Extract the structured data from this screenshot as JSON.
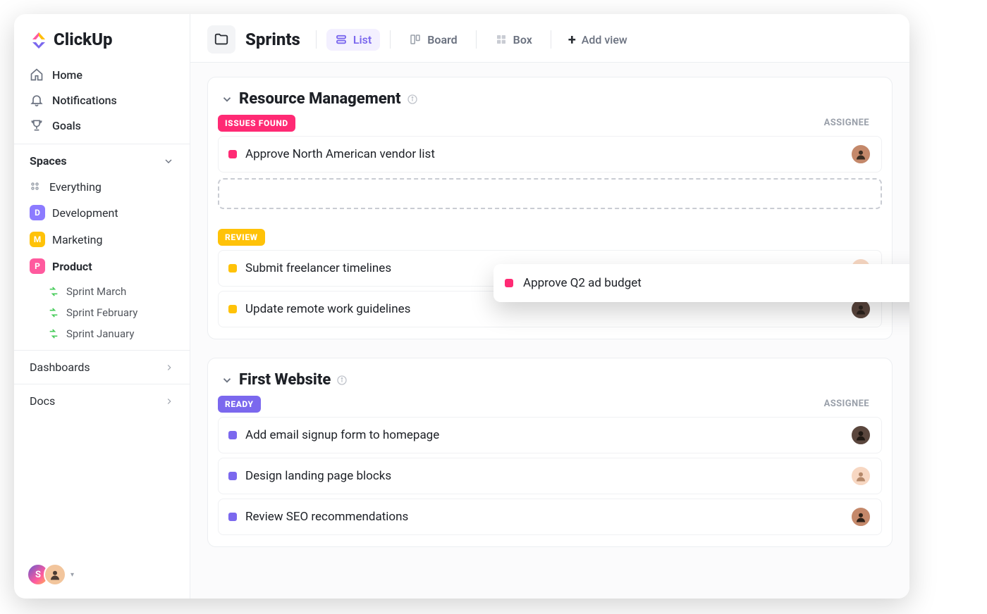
{
  "brand": {
    "name": "ClickUp"
  },
  "nav": {
    "home": "Home",
    "notifications": "Notifications",
    "goals": "Goals"
  },
  "spaces": {
    "header": "Spaces",
    "everything": "Everything",
    "items": [
      {
        "initial": "D",
        "label": "Development",
        "color": "#8C7BFF"
      },
      {
        "initial": "M",
        "label": "Marketing",
        "color": "#FFC208"
      },
      {
        "initial": "P",
        "label": "Product",
        "color": "#FF5A9E"
      }
    ],
    "children": [
      {
        "label": "Sprint  March"
      },
      {
        "label": "Sprint  February"
      },
      {
        "label": "Sprint January"
      }
    ]
  },
  "sections": {
    "dashboards": "Dashboards",
    "docs": "Docs"
  },
  "topbar": {
    "page_title": "Sprints",
    "views": {
      "list": "List",
      "board": "Board",
      "box": "Box",
      "add": "Add view"
    }
  },
  "labels": {
    "assignee": "ASSIGNEE"
  },
  "colors": {
    "accent_purple": "#7B68EE",
    "issues_found": "#FF2A74",
    "review": "#FFC208",
    "ready": "#7B68EE"
  },
  "groups": [
    {
      "title": "Resource Management",
      "blocks": [
        {
          "status_label": "ISSUES FOUND",
          "status_color": "#FF2A74",
          "tasks": [
            {
              "title": "Approve North American vendor list",
              "dot": "#FF2A74",
              "assignee": "person-1"
            }
          ],
          "show_dropzone": true
        },
        {
          "status_label": "REVIEW",
          "status_color": "#FFC208",
          "tasks": [
            {
              "title": "Submit freelancer timelines",
              "dot": "#FFC208",
              "assignee": "person-2"
            },
            {
              "title": "Update remote work guidelines",
              "dot": "#FFC208",
              "assignee": "person-3"
            }
          ]
        }
      ]
    },
    {
      "title": "First Website",
      "blocks": [
        {
          "status_label": "READY",
          "status_color": "#7B68EE",
          "tasks": [
            {
              "title": "Add email signup form to homepage",
              "dot": "#7B68EE",
              "assignee": "person-4"
            },
            {
              "title": "Design landing page blocks",
              "dot": "#7B68EE",
              "assignee": "person-5"
            },
            {
              "title": "Review SEO recommendations",
              "dot": "#7B68EE",
              "assignee": "person-6"
            }
          ]
        }
      ]
    }
  ],
  "drag": {
    "title": "Approve Q2 ad budget",
    "dot": "#FF2A74",
    "assignee": "person-7"
  },
  "assignee_colors": {
    "person-1": "skin3",
    "person-2": "skin5",
    "person-3": "skin4",
    "person-4": "skin4",
    "person-5": "skin5",
    "person-6": "skin3",
    "person-7": "skin2"
  }
}
